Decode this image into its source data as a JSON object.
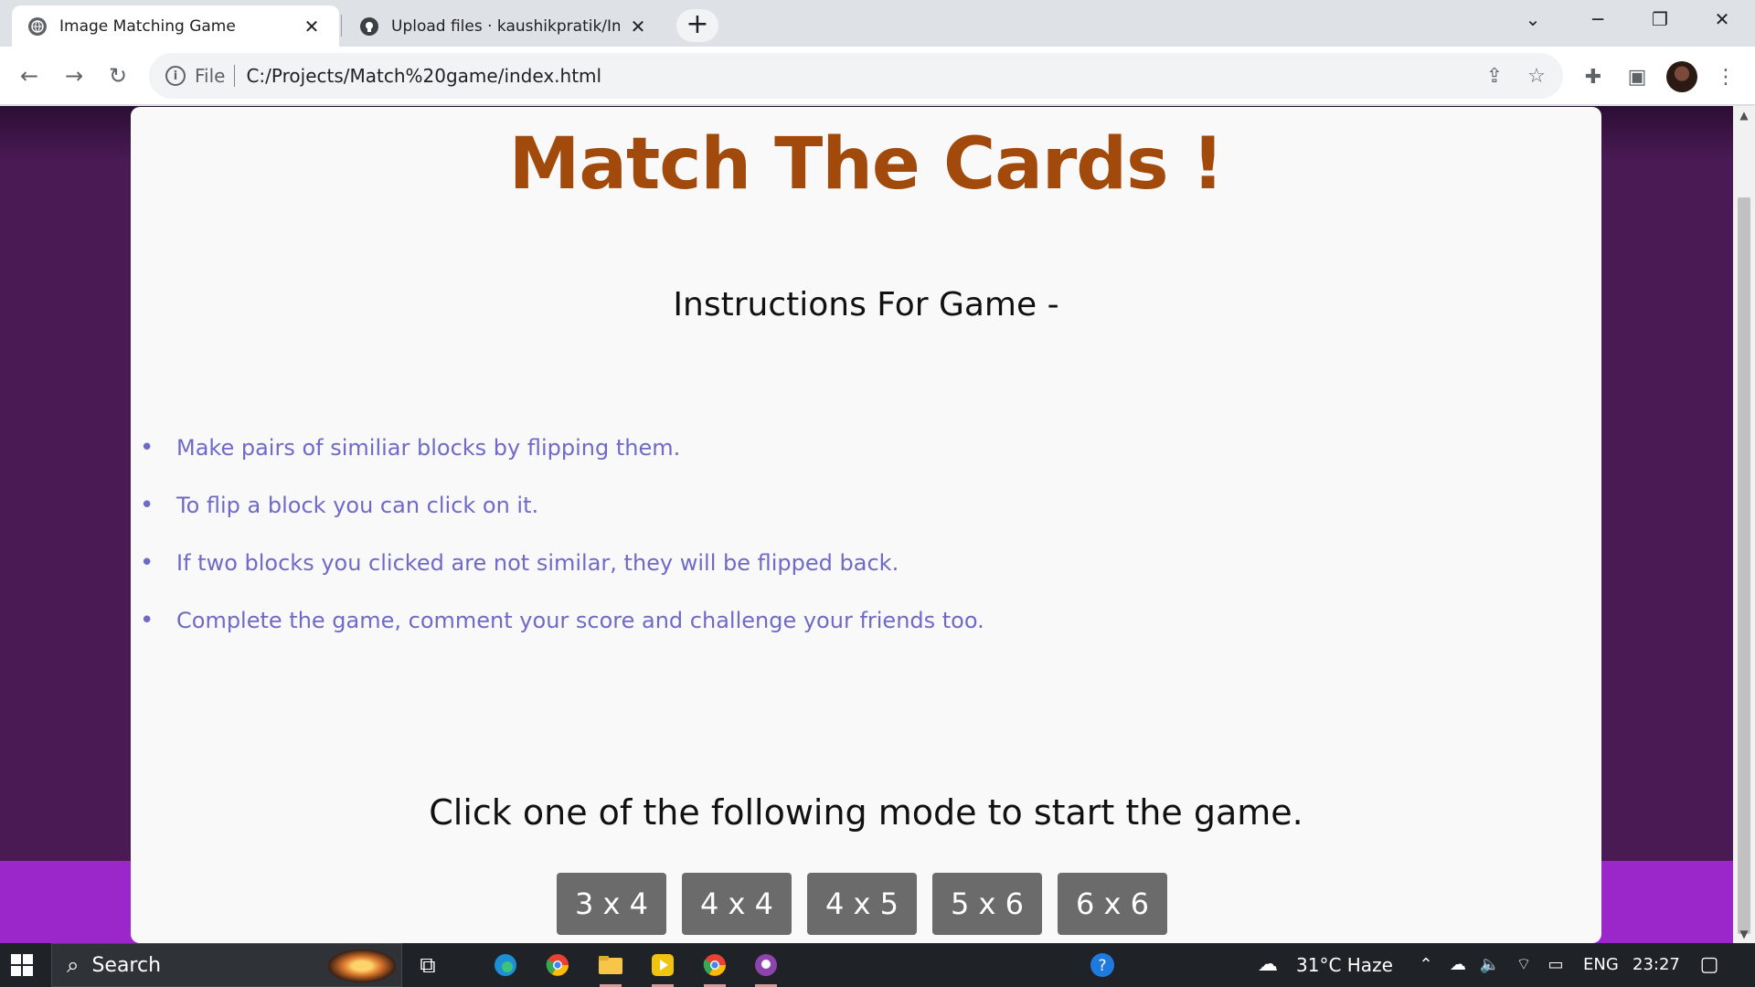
{
  "browser": {
    "tabs": [
      {
        "title": "Image Matching Game",
        "icon": "globe-icon",
        "active": true
      },
      {
        "title": "Upload files · kaushikpratik/Imag",
        "icon": "github-icon",
        "active": false
      }
    ],
    "new_tab_icon": "plus-icon",
    "address": {
      "scheme_label": "File",
      "url": "C:/Projects/Match%20game/index.html"
    }
  },
  "page": {
    "title": "Match The Cards !",
    "instructions_heading": "Instructions For Game -",
    "instructions": [
      "Make pairs of similiar blocks by flipping them.",
      "To flip a block you can click on it.",
      "If two blocks you clicked are not similar, they will be flipped back.",
      "Complete the game, comment your score and challenge your friends too."
    ],
    "mode_prompt": "Click one of the following mode to start the game.",
    "modes": [
      "3 x 4",
      "4 x 4",
      "4 x 5",
      "5 x 6",
      "6 x 6"
    ],
    "colors": {
      "title": "#a14a0b",
      "instructions": "#6f6ac7",
      "background": "#4a1a55",
      "band": "#9b26c9",
      "button": "#6b6b6b"
    }
  },
  "taskbar": {
    "search_label": "Search",
    "weather": "31°C  Haze",
    "language": "ENG",
    "time": "23:27"
  }
}
